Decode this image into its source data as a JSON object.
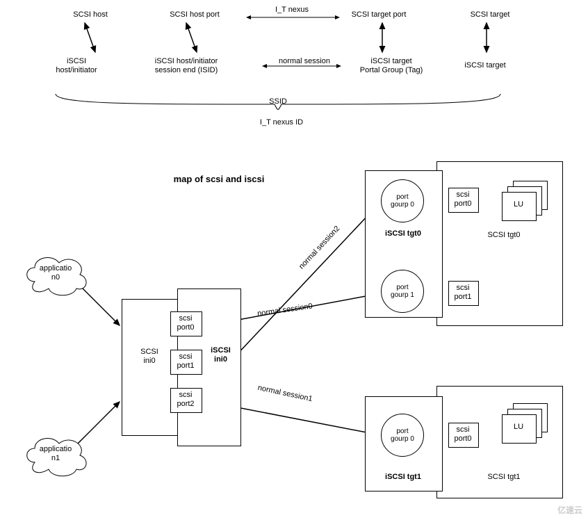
{
  "top": {
    "scsiHost": "SCSI host",
    "scsiHostPort": "SCSI host port",
    "itNexus": "I_T nexus",
    "scsiTargetPort": "SCSI target port",
    "scsiTarget": "SCSI target",
    "iscsiHostInitiator1": "iSCSI",
    "iscsiHostInitiator2": "host/initiator",
    "iscsiIsid1": "iSCSI host/initiator",
    "iscsiIsid2": "session end (ISID)",
    "normalSession": "normal session",
    "iscsiTgtPg1": "iSCSI target",
    "iscsiTgtPg2": "Portal Group (Tag)",
    "iscsiTarget": "iSCSI target",
    "ssid": "SSID",
    "itNexusId": "I_T nexus ID"
  },
  "title": "map of scsi and iscsi",
  "apps": {
    "a0": "applicatio\nn0",
    "a1": "applicatio\nn1"
  },
  "ini": {
    "scsi": "SCSI\nini0",
    "iscsi": "iSCSI\nini0",
    "p0": "scsi\nport0",
    "p1": "scsi\nport1",
    "p2": "scsi\nport2"
  },
  "sessions": {
    "s0": "normal session0",
    "s1": "normal session1",
    "s2": "normal session2"
  },
  "tgt0": {
    "iscsi": "iSCSI tgt0",
    "scsi": "SCSI tgt0",
    "pg0": "port\ngourp 0",
    "pg1": "port\ngourp 1",
    "sp0": "scsi\nport0",
    "sp1": "scsi\nport1",
    "lu": "LU"
  },
  "tgt1": {
    "iscsi": "iSCSI tgt1",
    "scsi": "SCSI tgt1",
    "pg0": "port\ngourp 0",
    "sp0": "scsi\nport0",
    "lu": "LU"
  },
  "watermark": "亿速云"
}
